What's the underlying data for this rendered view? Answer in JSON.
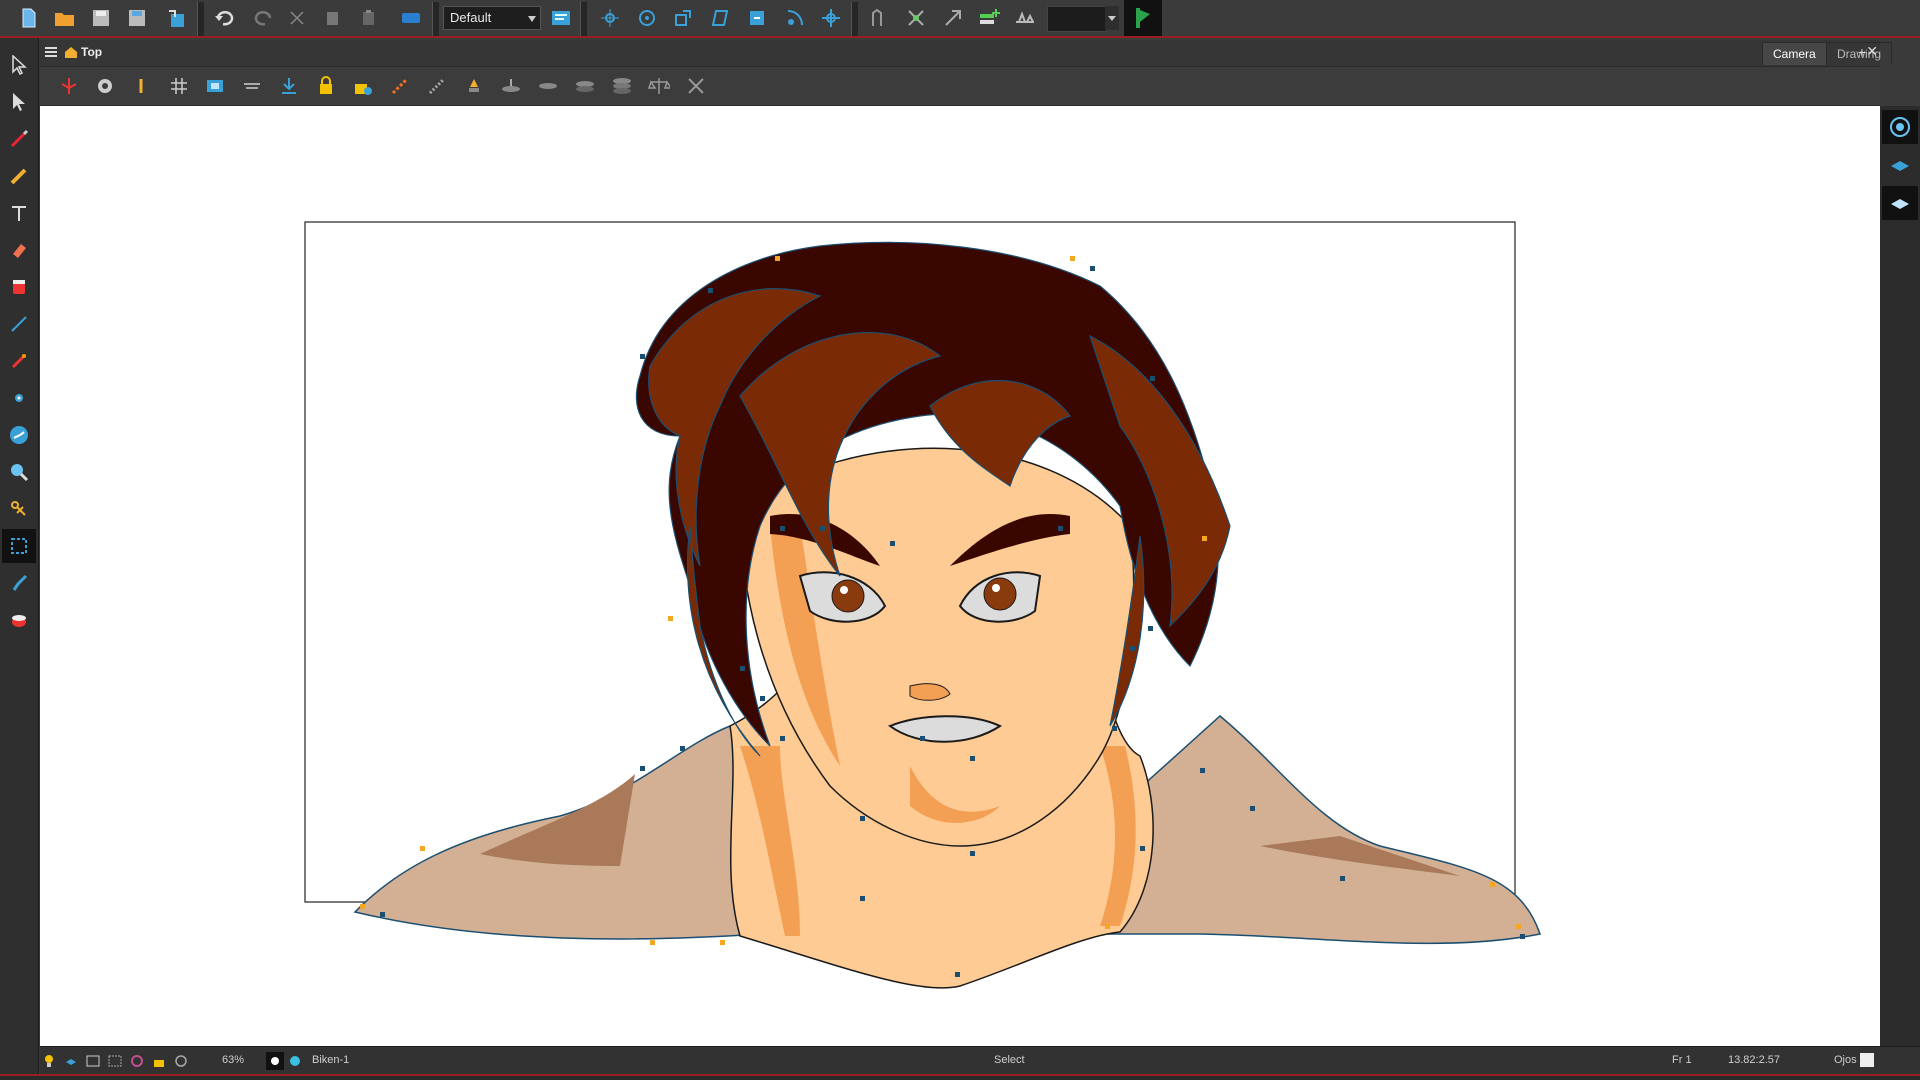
{
  "top_toolbar": {
    "preset_select": "Default",
    "buttons": [
      "new-scene-icon",
      "open-scene-icon",
      "save-icon",
      "save-as-icon",
      "import-icon",
      "undo-icon",
      "redo-icon",
      "cut-icon",
      "copy-icon",
      "paste-icon",
      "library-icon",
      "layout-icon",
      "transform-icon",
      "rotate-icon",
      "scale-icon",
      "skew-icon",
      "move-icon",
      "pivot-icon",
      "reposition-icon",
      "ik-icon",
      "ik-hold-icon",
      "ik-min-max-icon",
      "add-peg-icon",
      "deformation-icon",
      "onion-skin-icon"
    ]
  },
  "left_toolbar": {
    "tools": [
      "select-tool",
      "contour-editor-tool",
      "brush-tool",
      "pencil-tool",
      "text-tool",
      "eraser-tool",
      "paint-tool",
      "line-tool",
      "stroke-tool",
      "pivot-tool",
      "colour-picker-tool",
      "zoom-tool",
      "rigging-tool",
      "cutter-tool",
      "inverse-kinematics-tool",
      "paint-bucket-tool"
    ],
    "active_index": 13
  },
  "view": {
    "breadcrumb": "Top",
    "tabs": [
      {
        "label": "Camera",
        "active": true
      },
      {
        "label": "Drawing",
        "active": false
      }
    ],
    "add_symbol": "+",
    "close_symbol": "✕"
  },
  "camera_toolbar": {
    "buttons": [
      "reset-view-icon",
      "settings-icon",
      "light-table-icon",
      "grid-icon",
      "safe-area-icon",
      "field-guide-icon",
      "auto-apply-icon",
      "lock-icon",
      "lock-all-icon",
      "bone-icon",
      "ruler-icon",
      "shade-icon",
      "flatten-icon",
      "layer-icon",
      "stack-icon",
      "stack-more-icon",
      "balance-icon",
      "cut-icon"
    ]
  },
  "side_dock": {
    "buttons": [
      "show-layers-icon",
      "line-art-layer-icon",
      "colour-art-layer-icon"
    ]
  },
  "status_bar": {
    "zoom": "63%",
    "drawing_name": "Biken-1",
    "tool_name": "Select",
    "frame": "Fr 1",
    "coordinates": "13.82:2.57",
    "layer_name": "Ojos"
  },
  "colors": {
    "accent_red": "#9a1f24",
    "panel_bg": "#3b3b3b",
    "canvas_bg": "#ffffff",
    "hair_dark": "#3a0700",
    "hair_mid": "#7a2a05",
    "skin": "#fdcb93",
    "skin_shadow": "#f3a055",
    "jacket": "#d3b094",
    "control_point_blue": "#1b4f72",
    "control_point_orange": "#f5a623"
  }
}
